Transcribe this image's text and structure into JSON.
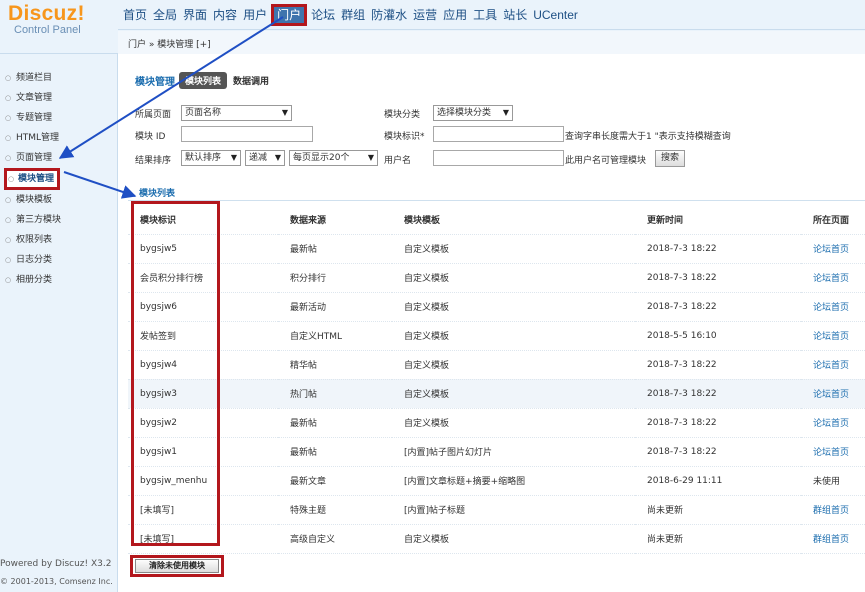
{
  "logo": {
    "brand": "Discuz!",
    "subtitle": "Control Panel"
  },
  "nav": {
    "items": [
      "首页",
      "全局",
      "界面",
      "内容",
      "用户",
      "门户",
      "论坛",
      "群组",
      "防灌水",
      "运营",
      "应用",
      "工具",
      "站长",
      "UCenter"
    ],
    "active_index": 5
  },
  "breadcrumb": "门户 » 模块管理 [+]",
  "sidebar": {
    "items": [
      "频道栏目",
      "文章管理",
      "专题管理",
      "HTML管理",
      "页面管理",
      "模块管理",
      "模块模板",
      "第三方模块",
      "权限列表",
      "日志分类",
      "相册分类"
    ],
    "active_index": 5
  },
  "footer": {
    "powered": "Powered by Discuz! X3.2",
    "copyright": "© 2001-2013, Comsenz Inc."
  },
  "tabs": {
    "title": "模块管理",
    "active": "模块列表",
    "other": "数据调用"
  },
  "filters": {
    "page_label": "所属页面",
    "page_select": "页面名称",
    "category_label": "模块分类",
    "category_select": "选择模块分类",
    "id_label": "模块 ID",
    "id_value": "",
    "tag_label": "模块标识*",
    "tag_value": "",
    "tag_hint": "查询字串长度需大于1  \"表示支持模糊查询",
    "sort_label": "结果排序",
    "sort_select": "默认排序",
    "order_select": "递减",
    "perpage_select": "每页显示20个",
    "user_label": "用户名",
    "user_value": "",
    "user_hint": "此用户名可管理模块",
    "search_button": "搜索"
  },
  "list_title": "模块列表",
  "table": {
    "headers": [
      "模块标识",
      "数据来源",
      "模块模板",
      "更新时间",
      "所在页面"
    ],
    "rows": [
      [
        "bygsjw5",
        "最新帖",
        "自定义模板",
        "2018-7-3 18:22",
        "论坛首页"
      ],
      [
        "会员积分排行榜",
        "积分排行",
        "自定义模板",
        "2018-7-3 18:22",
        "论坛首页"
      ],
      [
        "bygsjw6",
        "最新活动",
        "自定义模板",
        "2018-7-3 18:22",
        "论坛首页"
      ],
      [
        "发帖签到",
        "自定义HTML",
        "自定义模板",
        "2018-5-5 16:10",
        "论坛首页"
      ],
      [
        "bygsjw4",
        "精华帖",
        "自定义模板",
        "2018-7-3 18:22",
        "论坛首页"
      ],
      [
        "bygsjw3",
        "热门帖",
        "自定义模板",
        "2018-7-3 18:22",
        "论坛首页"
      ],
      [
        "bygsjw2",
        "最新帖",
        "自定义模板",
        "2018-7-3 18:22",
        "论坛首页"
      ],
      [
        "bygsjw1",
        "最新帖",
        "[内置]帖子图片幻灯片",
        "2018-7-3 18:22",
        "论坛首页"
      ],
      [
        "bygsjw_menhu",
        "最新文章",
        "[内置]文章标题+摘要+缩略图",
        "2018-6-29 11:11",
        "未使用"
      ],
      [
        "[未填写]",
        "特殊主题",
        "[内置]帖子标题",
        "尚未更新",
        "群组首页"
      ],
      [
        "[未填写]",
        "高级自定义",
        "自定义模板",
        "尚未更新",
        "群组首页"
      ]
    ]
  },
  "clear_button": "清除未使用模块",
  "colors": {
    "highlight_box": "#b3171d",
    "arrow": "#1f4fc4",
    "link": "#1d6eaf",
    "brand": "#f7961c"
  }
}
